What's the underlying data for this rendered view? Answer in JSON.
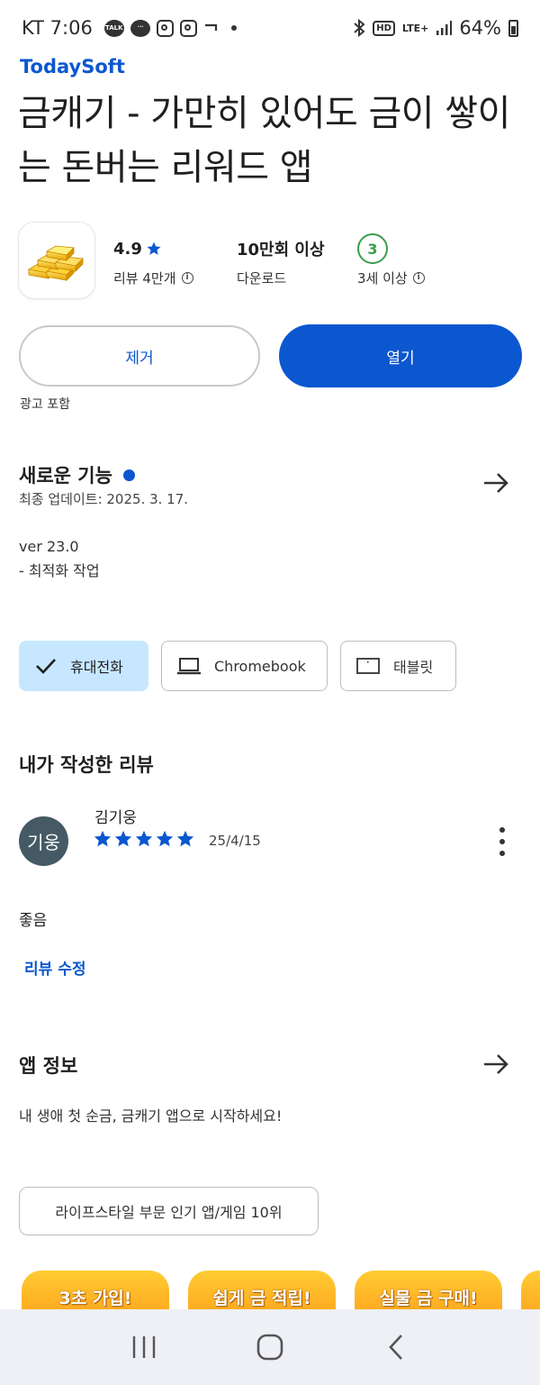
{
  "status_bar": {
    "carrier_time": "KT 7:06",
    "talk_badge": "TALK",
    "hd": "HD",
    "lte": "LTE+",
    "battery": "64%",
    "icons": [
      "kakaotalk-icon",
      "chat-icon",
      "instagram-icon",
      "instagram-icon",
      "nfc-icon",
      "dot-icon",
      "bluetooth-icon",
      "hd-voice-icon",
      "lte-icon",
      "signal-icon",
      "battery-icon"
    ]
  },
  "app": {
    "developer": "TodaySoft",
    "title": "금캐기 - 가만히 있어도 금이 쌓이는 돈버는 리워드 앱",
    "icon": "gold-bars-icon"
  },
  "stats": {
    "rating_value": "4.9",
    "rating_label": "리뷰 4만개",
    "downloads_value": "10만회 이상",
    "downloads_label": "다운로드",
    "age_badge": "3",
    "age_label": "3세 이상"
  },
  "actions": {
    "remove_label": "제거",
    "open_label": "열기",
    "ads_notice": "광고 포함"
  },
  "whats_new": {
    "title": "새로운 기능",
    "updated": "최종 업데이트: 2025. 3. 17.",
    "version": "ver 23.0",
    "notes": "- 최적화 작업"
  },
  "device_chips": [
    {
      "label": "휴대전화",
      "selected": true,
      "icon": "check-icon"
    },
    {
      "label": "Chromebook",
      "selected": false,
      "icon": "laptop-icon"
    },
    {
      "label": "태블릿",
      "selected": false,
      "icon": "tablet-icon"
    }
  ],
  "my_review": {
    "section_title": "내가 작성한 리뷰",
    "avatar_text": "기웅",
    "reviewer": "김기웅",
    "stars": 5,
    "date": "25/4/15",
    "text": "좋음",
    "edit_label": "리뷰 수정"
  },
  "about": {
    "title": "앱 정보",
    "description": "내 생애 첫 순금, 금캐기 앱으로 시작하세요!",
    "rank_chip": "라이프스타일 부문 인기 앱/게임 10위"
  },
  "promos": [
    "3초 가입!",
    "쉽게 금 적립!",
    "실물 금 구매!"
  ],
  "colors": {
    "accent": "#0b57d0",
    "chip_selected": "#c6e7ff",
    "age_green": "#3a9c4d",
    "avatar": "#455a64",
    "promo_orange": "#ffb020",
    "navbar": "#eef0f6"
  }
}
